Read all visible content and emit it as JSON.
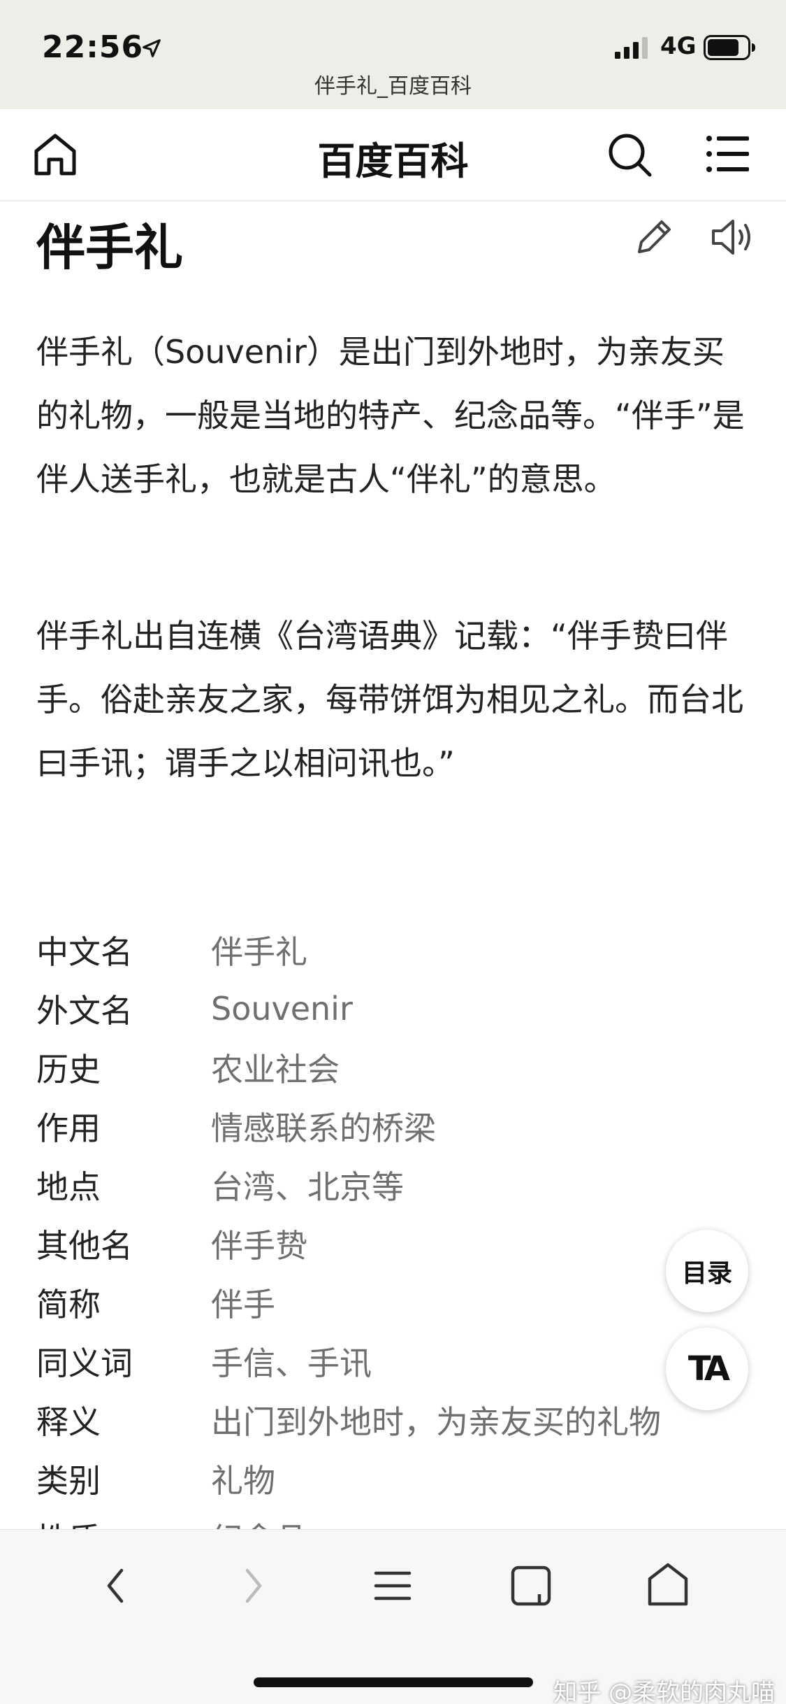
{
  "status_bar": {
    "time": "22:56",
    "network": "4G",
    "url_title": "伴手礼_百度百科"
  },
  "header": {
    "site_title": "百度百科",
    "icons": [
      "home-icon",
      "search-icon",
      "menu-icon"
    ]
  },
  "entry": {
    "title": "伴手礼",
    "icons": [
      "edit-icon",
      "audio-icon"
    ],
    "paragraphs": [
      "伴手礼（Souvenir）是出门到外地时，为亲友买的礼物，一般是当地的特产、纪念品等。“伴手”是伴人送手礼，也就是古人“伴礼”的意思。",
      "伴手礼出自连横《台湾语典》记载：“伴手贽曰伴手。俗赴亲友之家，每带饼饵为相见之礼。而台北曰手讯；谓手之以相问讯也。”"
    ]
  },
  "info_box": [
    {
      "key": "中文名",
      "value": "伴手礼"
    },
    {
      "key": "外文名",
      "value": "Souvenir"
    },
    {
      "key": "历史",
      "value": "农业社会"
    },
    {
      "key": "作用",
      "value": "情感联系的桥梁"
    },
    {
      "key": "地点",
      "value": "台湾、北京等"
    },
    {
      "key": "其他名",
      "value": "伴手贽"
    },
    {
      "key": "简称",
      "value": "伴手"
    },
    {
      "key": "同义词",
      "value": "手信、手讯"
    },
    {
      "key": "释义",
      "value": "出门到外地时，为亲友买的礼物"
    },
    {
      "key": "类别",
      "value": "礼物"
    },
    {
      "key": "性质",
      "value": "纪念品"
    }
  ],
  "floating": {
    "toc_label": "目录",
    "font_label": "TA"
  },
  "toolbar": {
    "icons": [
      "back-icon",
      "forward-icon",
      "list-icon",
      "tabs-icon",
      "home-icon"
    ]
  },
  "watermark": "知乎 @柔软的肉丸喵"
}
